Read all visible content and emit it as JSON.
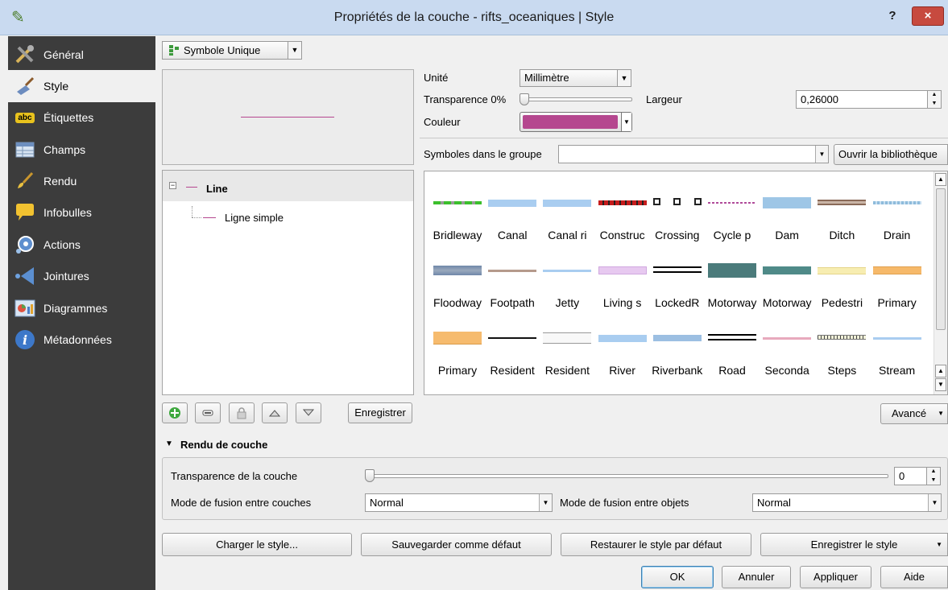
{
  "window": {
    "title": "Propriétés de la couche - rifts_oceaniques | Style",
    "help_label": "?",
    "close_label": "×"
  },
  "nav": {
    "items": [
      {
        "label": "Général",
        "icon": "tools-icon"
      },
      {
        "label": "Style",
        "icon": "brush-icon"
      },
      {
        "label": "Étiquettes",
        "icon": "abc-label-icon",
        "icon_text": "abc"
      },
      {
        "label": "Champs",
        "icon": "table-icon"
      },
      {
        "label": "Rendu",
        "icon": "paintbrush-icon"
      },
      {
        "label": "Infobulles",
        "icon": "speech-bubble-icon"
      },
      {
        "label": "Actions",
        "icon": "gear-actions-icon"
      },
      {
        "label": "Jointures",
        "icon": "join-arrow-icon"
      },
      {
        "label": "Diagrammes",
        "icon": "chart-icon"
      },
      {
        "label": "Métadonnées",
        "icon": "info-icon",
        "icon_text": "i"
      }
    ],
    "selected_index": 1
  },
  "renderer": {
    "type_label": "Symbole Unique"
  },
  "symbol_props": {
    "unit_label": "Unité",
    "unit_value": "Millimètre",
    "transparency_label": "Transparence 0%",
    "transparency_value": 0,
    "width_label": "Largeur",
    "width_value": "0,26000",
    "color_label": "Couleur",
    "color_hex": "#b5478f"
  },
  "tree": {
    "root_label": "Line",
    "child_label": "Ligne simple"
  },
  "library": {
    "group_label": "Symboles dans le groupe",
    "group_value": "",
    "open_button": "Ouvrir la bibliothèque",
    "symbols": [
      {
        "label": "Bridleway",
        "style": "dash-green"
      },
      {
        "label": "Canal",
        "style": "lightblue"
      },
      {
        "label": "Canal ri",
        "style": "lightblue"
      },
      {
        "label": "Construc",
        "style": "dash-red"
      },
      {
        "label": "Crossing",
        "style": "squares"
      },
      {
        "label": "Cycle p",
        "style": "dots-purple"
      },
      {
        "label": "Dam",
        "style": "blue-thick"
      },
      {
        "label": "Ditch",
        "style": "double-brown"
      },
      {
        "label": "Drain",
        "style": "dotted-blue"
      },
      {
        "label": "Floodway",
        "style": "grey-thick"
      },
      {
        "label": "Footpath",
        "style": "tan-thin"
      },
      {
        "label": "Jetty",
        "style": "lightblue-thin"
      },
      {
        "label": "Living s",
        "style": "lavender"
      },
      {
        "label": "LockedR",
        "style": "double-black"
      },
      {
        "label": "Motorway",
        "style": "teal-thick"
      },
      {
        "label": "Motorway",
        "style": "teal"
      },
      {
        "label": "Pedestri",
        "style": "yellow"
      },
      {
        "label": "Primary",
        "style": "orange"
      },
      {
        "label": "Primary",
        "style": "orange-thick"
      },
      {
        "label": "Resident",
        "style": "black-thin"
      },
      {
        "label": "Resident",
        "style": "white-border"
      },
      {
        "label": "River",
        "style": "lightblue"
      },
      {
        "label": "Riverbank",
        "style": "steelblue"
      },
      {
        "label": "Road",
        "style": "double-black"
      },
      {
        "label": "Seconda",
        "style": "pink"
      },
      {
        "label": "Steps",
        "style": "steps"
      },
      {
        "label": "Stream",
        "style": "lightblue-thin"
      }
    ]
  },
  "tree_toolbar": {
    "save_label": "Enregistrer",
    "advanced_label": "Avancé"
  },
  "layer_render": {
    "section_title": "Rendu de couche",
    "layer_transparency_label": "Transparence de la couche",
    "layer_transparency_value": "0",
    "layer_blend_label": "Mode de fusion entre couches",
    "layer_blend_value": "Normal",
    "feature_blend_label": "Mode de fusion entre objets",
    "feature_blend_value": "Normal"
  },
  "bottom": {
    "load_style": "Charger le style...",
    "save_default": "Sauvegarder comme défaut",
    "restore_default": "Restaurer le style par défaut",
    "save_style": "Enregistrer le style",
    "ok": "OK",
    "cancel": "Annuler",
    "apply": "Appliquer",
    "help": "Aide"
  }
}
